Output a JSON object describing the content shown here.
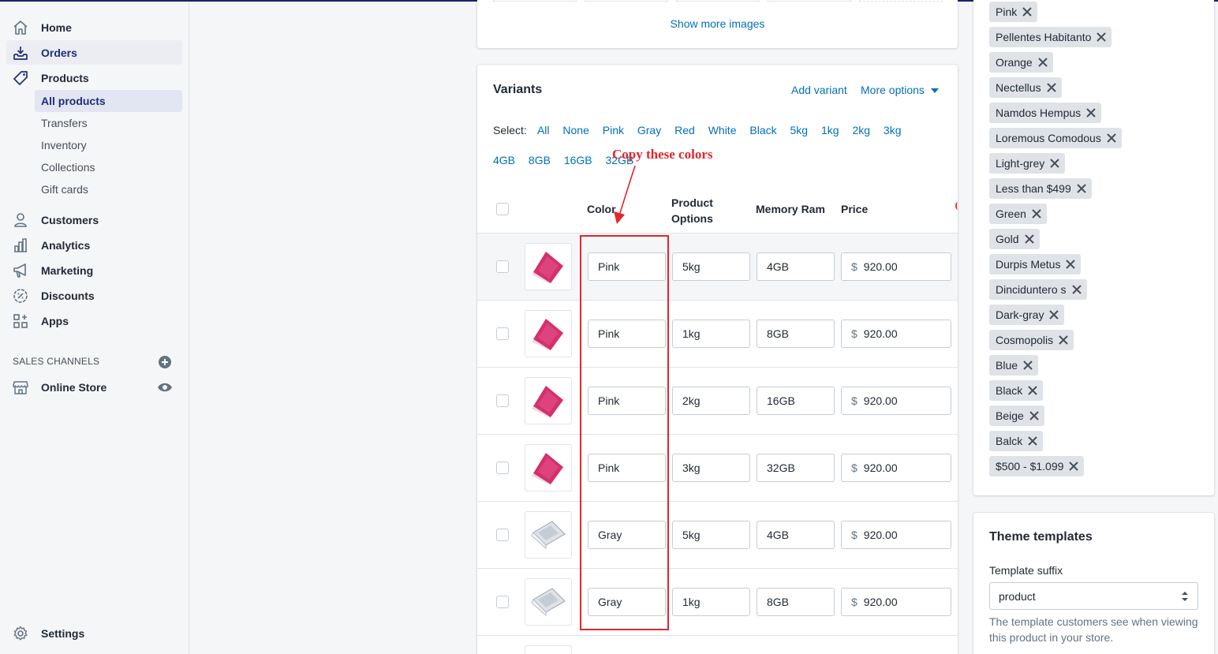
{
  "sidebar": {
    "nav": [
      {
        "label": "Home",
        "icon": "home-icon"
      },
      {
        "label": "Orders",
        "icon": "orders-icon"
      },
      {
        "label": "Products",
        "icon": "tag-icon"
      }
    ],
    "products_sub": [
      "All products",
      "Transfers",
      "Inventory",
      "Collections",
      "Gift cards"
    ],
    "nav2": [
      {
        "label": "Customers",
        "icon": "person-icon"
      },
      {
        "label": "Analytics",
        "icon": "bar-chart-icon"
      },
      {
        "label": "Marketing",
        "icon": "megaphone-icon"
      },
      {
        "label": "Discounts",
        "icon": "discount-icon"
      },
      {
        "label": "Apps",
        "icon": "apps-icon"
      }
    ],
    "sales_channels_title": "SALES CHANNELS",
    "online_store": "Online Store",
    "settings": "Settings"
  },
  "media": {
    "show_more": "Show more images"
  },
  "variants": {
    "title": "Variants",
    "add_variant": "Add variant",
    "more_options": "More options",
    "select_label": "Select:",
    "select_options": [
      "All",
      "None",
      "Pink",
      "Gray",
      "Red",
      "White",
      "Black",
      "5kg",
      "1kg",
      "2kg",
      "3kg",
      "4GB",
      "8GB",
      "16GB",
      "32GB"
    ],
    "headers": {
      "color": "Color",
      "product_options_1": "Product",
      "product_options_2": "Options",
      "memory": "Memory Ram",
      "price": "Price"
    },
    "currency": "$",
    "rows": [
      {
        "color": "Pink",
        "option": "5kg",
        "memory": "4GB",
        "price": "920.00"
      },
      {
        "color": "Pink",
        "option": "1kg",
        "memory": "8GB",
        "price": "920.00"
      },
      {
        "color": "Pink",
        "option": "2kg",
        "memory": "16GB",
        "price": "920.00"
      },
      {
        "color": "Pink",
        "option": "3kg",
        "memory": "32GB",
        "price": "920.00"
      },
      {
        "color": "Gray",
        "option": "5kg",
        "memory": "4GB",
        "price": "920.00"
      },
      {
        "color": "Gray",
        "option": "1kg",
        "memory": "8GB",
        "price": "920.00"
      }
    ]
  },
  "annotation": {
    "text": "Copy these colors"
  },
  "tags": [
    "Pink",
    "Pellentes Habitanto",
    "Orange",
    "Nectellus",
    "Namdos Hempus",
    "Loremous Comodous",
    "Light-grey",
    "Less than $499",
    "Green",
    "Gold",
    "Durpis Metus",
    "Dinciduntero s",
    "Dark-gray",
    "Cosmopolis",
    "Blue",
    "Black",
    "Beige",
    "Balck",
    "$500 - $1.099"
  ],
  "theme_templates": {
    "title": "Theme templates",
    "suffix_label": "Template suffix",
    "suffix_value": "product",
    "help": "The template customers see when viewing this product in your store."
  },
  "colors": {
    "accent": "#006fbb",
    "nav_active": "#202e78",
    "annotation": "#e3262d",
    "pink_laptop": "#d4306d"
  }
}
